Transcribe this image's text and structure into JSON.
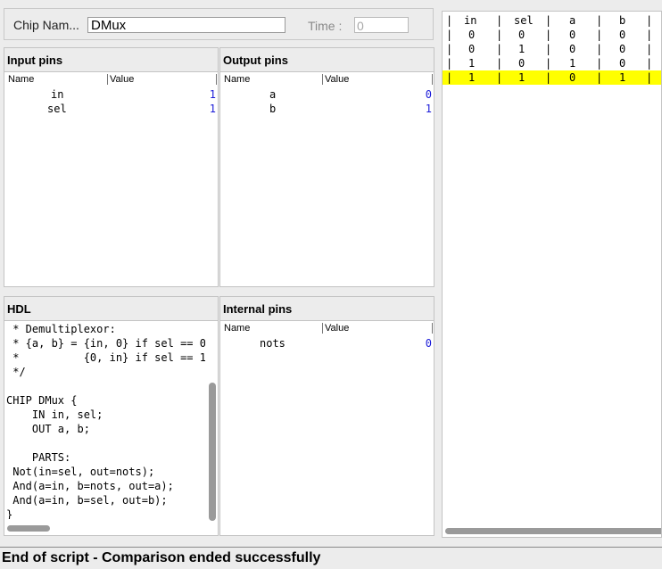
{
  "chip": {
    "label": "Chip Nam...",
    "name": "DMux",
    "time_label": "Time :",
    "time_value": "0"
  },
  "input_pins": {
    "title": "Input pins",
    "col_name": "Name",
    "col_value": "Value",
    "rows": [
      {
        "name": "in",
        "value": "1"
      },
      {
        "name": "sel",
        "value": "1"
      }
    ]
  },
  "output_pins": {
    "title": "Output pins",
    "col_name": "Name",
    "col_value": "Value",
    "rows": [
      {
        "name": "a",
        "value": "0"
      },
      {
        "name": "b",
        "value": "1"
      }
    ]
  },
  "hdl": {
    "title": "HDL",
    "lines": [
      " * Demultiplexor:",
      " * {a, b} = {in, 0} if sel == 0",
      " *          {0, in} if sel == 1",
      " */",
      "",
      "CHIP DMux {",
      "    IN in, sel;",
      "    OUT a, b;",
      "",
      "    PARTS:",
      " Not(in=sel, out=nots);",
      " And(a=in, b=nots, out=a);",
      " And(a=in, b=sel, out=b);",
      "}"
    ]
  },
  "internal_pins": {
    "title": "Internal pins",
    "col_name": "Name",
    "col_value": "Value",
    "rows": [
      {
        "name": "nots",
        "value": "0"
      }
    ]
  },
  "truth_table": {
    "headers": [
      "in",
      "sel",
      "a",
      "b"
    ],
    "rows": [
      [
        "0",
        "0",
        "0",
        "0"
      ],
      [
        "0",
        "1",
        "0",
        "0"
      ],
      [
        "1",
        "0",
        "1",
        "0"
      ],
      [
        "1",
        "1",
        "0",
        "1"
      ]
    ],
    "highlighted_row": 3,
    "highlight_color": "#ffff00"
  },
  "status": {
    "text": "End of script - Comparison ended successfully"
  }
}
